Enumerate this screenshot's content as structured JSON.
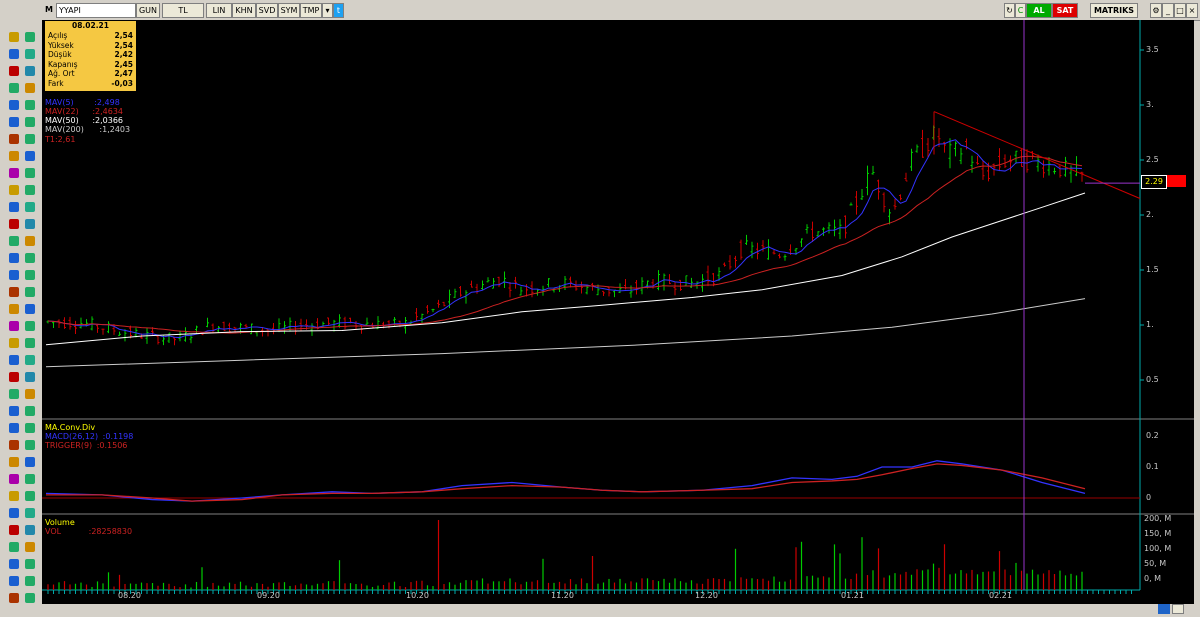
{
  "topbar": {
    "symbol_prefix": "M",
    "symbol": "YYAPI",
    "buttons": [
      "GUN",
      "TL",
      "LIN",
      "KHN",
      "SVD",
      "SYM",
      "TMP"
    ],
    "buy_label": "AL",
    "sell_label": "SAT",
    "brand": "MATRIKS"
  },
  "info_box": {
    "date": "08.02.21",
    "rows": [
      {
        "key": "Açılış",
        "value": "2,54"
      },
      {
        "key": "Yüksek",
        "value": "2,54"
      },
      {
        "key": "Düşük",
        "value": "2,42"
      },
      {
        "key": "Kapanış",
        "value": "2,45"
      },
      {
        "key": "Ağ. Ort",
        "value": "2,47"
      },
      {
        "key": "Fark",
        "value": "-0,03"
      }
    ]
  },
  "price_panel": {
    "indicators": [
      {
        "label": "MAV(5)",
        "value": ":2,498",
        "color": "#3333ff"
      },
      {
        "label": "MAV(22)",
        "value": ":2,4634",
        "color": "#cc2222"
      },
      {
        "label": "MAV(50)",
        "value": ":2,0366",
        "color": "#ffffff"
      },
      {
        "label": "MAV(200)",
        "value": ":1,2403",
        "color": "#cccccc"
      },
      {
        "label": "T1:2,61",
        "value": "",
        "color": "#cc2222"
      }
    ],
    "y_ticks": [
      "3.5",
      "3.",
      "2.5",
      "2.",
      "1.5",
      "1.",
      "0.5"
    ],
    "last_price": "2.29"
  },
  "macd_panel": {
    "title": "MA.Conv.Div",
    "lines": [
      {
        "label": "MACD(26,12)",
        "value": ":0.1198",
        "color": "#3333ff"
      },
      {
        "label": "TRIGGER(9)",
        "value": ":0.1506",
        "color": "#cc2222"
      }
    ],
    "y_ticks": [
      "0.2",
      "0.1",
      "0"
    ]
  },
  "volume_panel": {
    "title": "Volume",
    "vol_label": "VOL",
    "vol_value": ":28258830",
    "y_ticks": [
      "200, M",
      "150, M",
      "100, M",
      "50, M",
      "0, M"
    ]
  },
  "x_axis": [
    "08.20",
    "09.20",
    "10.20",
    "11.20",
    "12.20",
    "01.21",
    "02.21"
  ],
  "colors": {
    "up": "#00cc00",
    "down": "#cc0000",
    "mav5": "#3333ff",
    "mav22": "#cc2222",
    "mav50": "#ffffff",
    "mav200": "#cccccc",
    "trend": "#cc0000",
    "cursor": "#9933cc"
  }
}
